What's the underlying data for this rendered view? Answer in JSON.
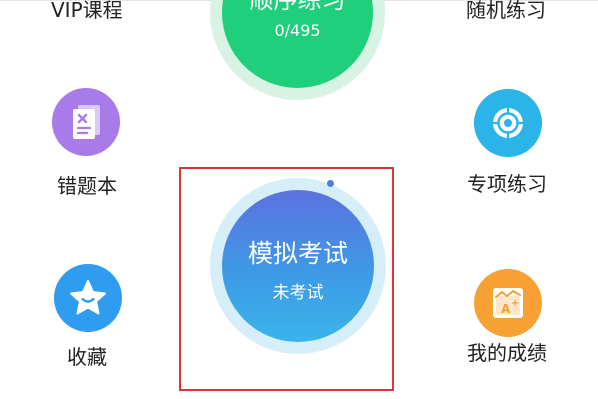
{
  "top_row": {
    "vip_label": "VIP课程",
    "random_label": "随机练习"
  },
  "sequential": {
    "title": "顺序练习",
    "count": "0/495"
  },
  "mistakes": {
    "label": "错题本",
    "icon": "mistake-notebook-icon",
    "color": "#a97be8"
  },
  "special": {
    "label": "专项练习",
    "icon": "target-icon",
    "color": "#2ab4e8"
  },
  "mock_exam": {
    "title": "模拟考试",
    "status": "未考试"
  },
  "favorites": {
    "label": "收藏",
    "icon": "star-icon",
    "color": "#2f9cf0"
  },
  "scores": {
    "label": "我的成绩",
    "icon": "grade-card-icon",
    "color": "#f7a134"
  },
  "highlight_color": "#d9363a"
}
